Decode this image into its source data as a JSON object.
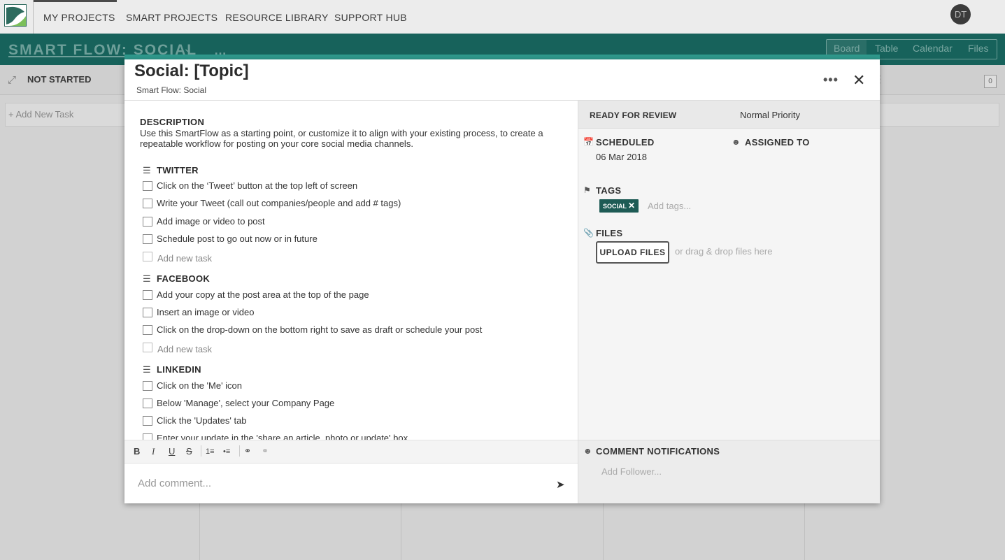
{
  "colors": {
    "brand_dark": "#17625b",
    "modal_accent": "#2f9a8d",
    "tag_bg": "#1e5b55"
  },
  "nav": {
    "logo_icon": "app-logo",
    "links": [
      "MY PROJECTS",
      "SMART PROJECTS",
      "RESOURCE LIBRARY",
      "SUPPORT HUB"
    ],
    "avatar_initials": "DT"
  },
  "project": {
    "title": "SMART FLOW: SOCIAL",
    "chevron_icon": "chevron-down-icon",
    "more_icon": "more-icon",
    "views": [
      "Board",
      "Table",
      "Calendar",
      "Files"
    ],
    "active_view": "Board"
  },
  "board": {
    "column_title": "NOT STARTED",
    "column_count": "0",
    "add_task_label": "+ Add New Task"
  },
  "task": {
    "title": "Social: [Topic]",
    "subtitle": "Smart Flow: Social",
    "description_label": "DESCRIPTION",
    "description": "Use this SmartFlow as a starting point, or customize it to align with your existing process, to create a repeatable workflow for posting on your core social media channels.",
    "checklists": [
      {
        "title": "TWITTER",
        "items": [
          "Click on the ‘Tweet’ button at the top left of screen",
          "Write your Tweet (call out companies/people and add # tags)",
          "Add image or video to post",
          "Schedule post to go out now or in future"
        ],
        "new_placeholder": "Add new task"
      },
      {
        "title": "FACEBOOK",
        "items": [
          "Add your copy at the post area at the top of the page",
          "Insert an image or video",
          "Click on the drop-down on the bottom right to save as draft or schedule your post"
        ],
        "new_placeholder": "Add new task"
      },
      {
        "title": "LINKEDIN",
        "items": [
          "Click on the 'Me' icon",
          "Below 'Manage', select your Company Page",
          "Click the 'Updates' tab",
          "Enter your update in the 'share an article, photo or update' box"
        ]
      }
    ],
    "comment_placeholder": "Add comment...",
    "status": "READY FOR REVIEW",
    "priority": "Normal Priority",
    "scheduled_label": "SCHEDULED",
    "scheduled_date": "06 Mar 2018",
    "assigned_label": "ASSIGNED TO",
    "tags_label": "TAGS",
    "tags": [
      "SOCIAL"
    ],
    "tags_placeholder": "Add tags...",
    "files_label": "FILES",
    "upload_label": "UPLOAD FILES",
    "drop_hint": "or drag & drop files here",
    "notifications_label": "COMMENT NOTIFICATIONS",
    "follower_placeholder": "Add Follower..."
  }
}
